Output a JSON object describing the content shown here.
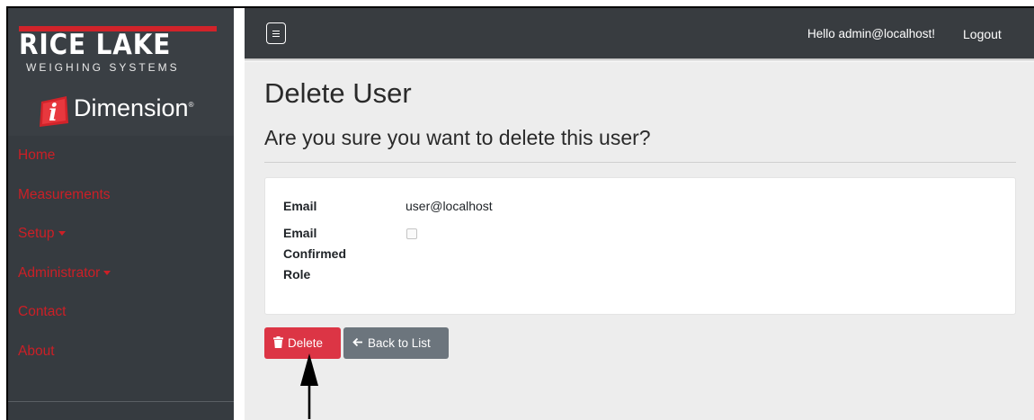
{
  "brand": {
    "company": "RICE LAKE",
    "company_sub": "WEIGHING SYSTEMS",
    "product": "Dimension",
    "colors": {
      "red": "#d1232a",
      "sidebar": "#363b40"
    }
  },
  "sidebar": {
    "items": [
      {
        "label": "Home",
        "has_caret": false
      },
      {
        "label": "Measurements",
        "has_caret": false
      },
      {
        "label": "Setup",
        "has_caret": true
      },
      {
        "label": "Administrator",
        "has_caret": true
      },
      {
        "label": "Contact",
        "has_caret": false
      },
      {
        "label": "About",
        "has_caret": false
      }
    ]
  },
  "topbar": {
    "toggler_icon": "hamburger-menu-icon",
    "greeting": "Hello admin@localhost!",
    "logout_label": "Logout"
  },
  "page": {
    "title": "Delete User",
    "confirmation": "Are you sure you want to delete this user?"
  },
  "details": {
    "email_label": "Email",
    "email_value": "user@localhost",
    "email_confirmed_label_line1": "Email",
    "email_confirmed_label_line2": "Confirmed",
    "email_confirmed_checked": false,
    "role_label": "Role",
    "role_value": ""
  },
  "actions": {
    "delete_label": "Delete",
    "delete_icon": "trash-icon",
    "back_label": "Back to List",
    "back_icon": "arrow-left-icon",
    "colors": {
      "delete": "#dc3545",
      "back": "#6c757d"
    }
  }
}
